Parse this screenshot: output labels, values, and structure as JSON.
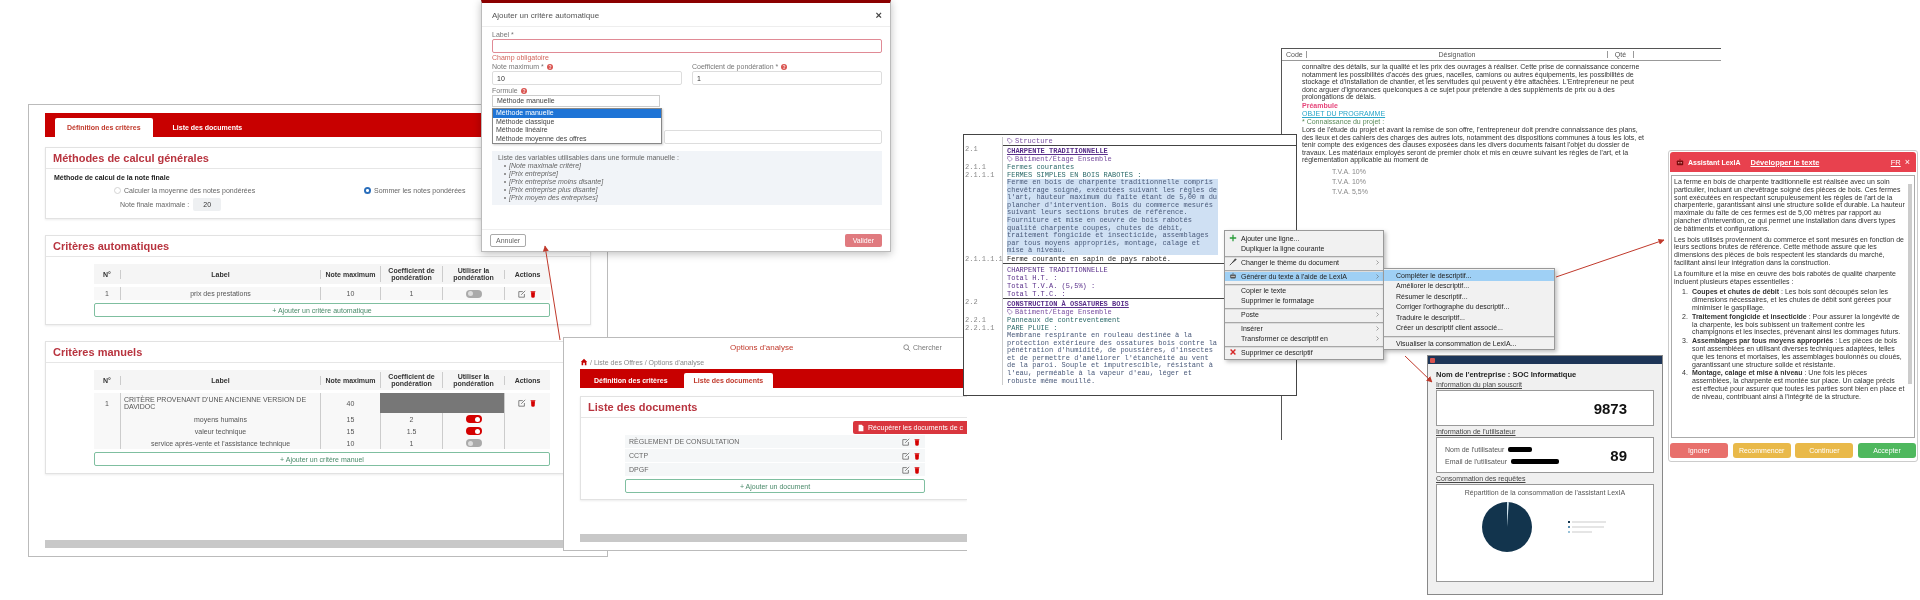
{
  "criteria": {
    "tabs": [
      {
        "label": "Définition des critères",
        "selected": true
      },
      {
        "label": "Liste des documents",
        "selected": false
      }
    ],
    "general": {
      "heading": "Méthodes de calcul générales",
      "method_label": "Méthode de calcul de la note finale",
      "options": [
        {
          "label": "Calculer la moyenne des notes pondérées",
          "selected": false
        },
        {
          "label": "Sommer les notes pondérées",
          "selected": true
        }
      ],
      "max_label": "Note finale maximale :",
      "max_value": "20"
    },
    "auto": {
      "heading": "Critères automatiques",
      "columns": [
        "N°",
        "Label",
        "Note maximum",
        "Coefficient de pondération",
        "Utiliser la pondération",
        "Actions"
      ],
      "rows": [
        {
          "n": "1",
          "label": "prix des prestations",
          "max": "10",
          "coef": "1",
          "weighted": false
        }
      ],
      "add": "+ Ajouter un critère automatique"
    },
    "manual": {
      "heading": "Critères manuels",
      "columns": [
        "N°",
        "Label",
        "Note maximum",
        "Coefficient de pondération",
        "Utiliser la pondération",
        "Actions"
      ],
      "rows": [
        {
          "n": "1",
          "label": "CRITÈRE PROVENANT D'UNE ANCIENNE VERSION DE DAVIDOC",
          "max": "40",
          "sub_criteria": [
            {
              "label": "moyens humains",
              "max": "15",
              "coef": "2",
              "weighted": true
            },
            {
              "label": "valeur technique",
              "max": "15",
              "coef": "1.5",
              "weighted": true
            },
            {
              "label": "service après-vente et l'assistance technique",
              "max": "10",
              "coef": "1",
              "weighted": false
            }
          ]
        }
      ],
      "add": "+ Ajouter un critère manuel"
    }
  },
  "modal": {
    "title": "Ajouter un critère automatique",
    "close": "×",
    "label_field": {
      "label": "Label *",
      "error": "Champ obligatoire"
    },
    "note_field": {
      "label": "Note maximum *",
      "value": "10"
    },
    "coef_field": {
      "label": "Coefficient de pondération *",
      "value": "1"
    },
    "formula": {
      "label": "Formule",
      "value": "Méthode manuelle",
      "options": [
        {
          "label": "Méthode manuelle",
          "selected": true
        },
        {
          "label": "Méthode classique",
          "selected": false
        },
        {
          "label": "Méthode linéaire",
          "selected": false
        },
        {
          "label": "Méthode moyenne des offres",
          "selected": false
        }
      ]
    },
    "help": {
      "intro": "Liste des variables utilisables dans une formule manuelle :",
      "items": [
        "[Note maximale critère]",
        "[Prix entreprise]",
        "[Prix entreprise moins disante]",
        "[Prix entreprise plus disante]",
        "[Prix moyen des entreprises]"
      ]
    },
    "cancel": "Annuler",
    "submit": "Valider"
  },
  "documents": {
    "title": "Options d'analyse",
    "search_placeholder": "Chercher",
    "breadcrumb": "/ Liste des Offres / Options d'analyse",
    "tabs": [
      {
        "label": "Définition des critères",
        "selected": false
      },
      {
        "label": "Liste des documents",
        "selected": true
      }
    ],
    "heading": "Liste des documents",
    "fetch_button": "Récupérer les documents de c",
    "items": [
      "RÈGLEMENT DE CONSULTATION",
      "CCTP",
      "DPGF"
    ],
    "add": "+ Ajouter un document"
  },
  "background_doc": {
    "columns": [
      "Code",
      "Désignation",
      "Qté"
    ],
    "blocks": [
      {
        "kind": "text",
        "text": "connaître des détails, sur la qualité et les prix des ouvrages à réaliser. Cette prise de connaissance concerne notamment les possibilités d'accès des grues, nacelles, camions ou autres équipements, les possibilités de stockage et d'installation de chantier, et les servitudes qui peuvent y être attachées. L'Entrepreneur ne peut donc arguer d'ignorances quelconques à ce sujet pour prétendre à des suppléments de prix ou à des prolongations de délais."
      },
      {
        "kind": "heading",
        "text": "Préambule"
      },
      {
        "kind": "link",
        "text": "OBJET DU PROGRAMME"
      },
      {
        "kind": "note",
        "text": "* Connaissance du projet :"
      },
      {
        "kind": "text",
        "text": "Lors de l'étude du projet et avant la remise de son offre, l'entrepreneur doit prendre connaissance des plans, des lieux et des cahiers des charges des autres lots, notamment des dispositions communes à tous les lots, et tenir compte des exigences des clauses exposées dans les divers documents faisant l'objet du dossier de travaux. Les matériaux employés seront de premier choix et mis en œuvre suivant les règles de l'art, et la réglementation applicable au moment de"
      }
    ],
    "tva": [
      "T.V.A. 10%",
      "T.V.A. 10%",
      "T.V.A. 5,5%"
    ]
  },
  "editor": {
    "lines": [
      {
        "kind": "tag",
        "text": "Structure"
      },
      {
        "kind": "title",
        "num": "2.1",
        "text": "CHARPENTE TRADITIONNELLE"
      },
      {
        "kind": "tag",
        "text": "Bâtiment/Étage Ensemble"
      },
      {
        "kind": "subtitle",
        "num": "2.1.1",
        "text": "Fermes courantes"
      },
      {
        "kind": "item",
        "num": "2.1.1.1",
        "text": "FERMES SIMPLES EN BOIS RABOTÉS :"
      },
      {
        "kind": "para",
        "selected": true,
        "text": "Ferme en bois de charpente traditionnelle compris chevêtrage soigné, exécutées suivant les règles de l'art, hauteur maximum du faîte étant de 5,00 m du plancher d'intervention. Bois du commerce mesurés suivant leurs sections brutes de référence. Fourniture et mise en oeuvre de bois rabotés qualité charpente coupes, chutes de débit, traitement fongicide et insecticide, assemblages par tous moyens appropriés, montage, calage et mise à niveau."
      },
      {
        "kind": "line",
        "num": "2.1.1.1.1",
        "text": "Ferme courante en sapin de pays raboté."
      },
      {
        "kind": "total-title",
        "text": "CHARPENTE TRADITIONNELLE"
      },
      {
        "kind": "total",
        "text": "Total H.T. :"
      },
      {
        "kind": "total",
        "text": "Total T.V.A. (5,5%) :"
      },
      {
        "kind": "total",
        "text": "Total T.T.C. :"
      },
      {
        "kind": "title",
        "num": "2.2",
        "text": "CONSTRUCTION À OSSATURES BOIS"
      },
      {
        "kind": "tag",
        "text": "Bâtiment/Étage Ensemble"
      },
      {
        "kind": "subtitle",
        "num": "2.2.1",
        "text": "Panneaux de contreventement"
      },
      {
        "kind": "item",
        "num": "2.2.1.1",
        "text": "PARE PLUIE :"
      },
      {
        "kind": "para",
        "selected": false,
        "text": "Membrane respirante en rouleau destinée à la protection extérieure des ossatures bois contre la pénétration d'humidité, de poussières, d'insectes et de permettre d'améliorer l'étanchéité au vent de la paroi. Souple et imputrescible, résistant à l'eau, perméable à la vapeur d'eau, léger et robuste même mouillé."
      }
    ]
  },
  "context_menu": {
    "items": [
      {
        "label": "Ajouter une ligne...",
        "submenu": false,
        "selected": false,
        "separator_before": false
      },
      {
        "label": "Dupliquer la ligne courante",
        "submenu": false,
        "selected": false,
        "separator_before": false
      },
      {
        "label": "Changer le thème du document",
        "submenu": true,
        "selected": false,
        "separator_before": true
      },
      {
        "label": "Générer du texte à l'aide de LexIA",
        "submenu": true,
        "selected": true,
        "separator_before": true
      },
      {
        "label": "Copier le texte",
        "submenu": false,
        "selected": false,
        "separator_before": true
      },
      {
        "label": "Supprimer le formatage",
        "submenu": false,
        "selected": false,
        "separator_before": false
      },
      {
        "label": "Poste",
        "submenu": true,
        "selected": false,
        "separator_before": true
      },
      {
        "label": "Insérer",
        "submenu": true,
        "selected": false,
        "separator_before": true
      },
      {
        "label": "Transformer ce descriptif en",
        "submenu": true,
        "selected": false,
        "separator_before": false
      },
      {
        "label": "Supprimer ce descriptif",
        "submenu": false,
        "selected": false,
        "separator_before": true
      }
    ],
    "submenu": [
      {
        "label": "Compléter le descriptif...",
        "selected": true,
        "separator_before": false
      },
      {
        "label": "Améliorer le descriptif...",
        "selected": false,
        "separator_before": false
      },
      {
        "label": "Résumer le descriptif...",
        "selected": false,
        "separator_before": false
      },
      {
        "label": "Corriger l'orthographe du descriptif...",
        "selected": false,
        "separator_before": false
      },
      {
        "label": "Traduire le descriptif...",
        "selected": false,
        "separator_before": false
      },
      {
        "label": "Créer un descriptif client associé...",
        "selected": false,
        "separator_before": false
      },
      {
        "label": "Visualiser la consommation de LexIA...",
        "selected": false,
        "separator_before": true
      }
    ]
  },
  "usage_dialog": {
    "company": "Nom de l'entreprise : SOC Informatique",
    "plan": {
      "heading": "Information du plan souscrit",
      "stat": "9873"
    },
    "user": {
      "heading": "Information de l'utilisateur",
      "fields": [
        "Nom de l'utilisateur",
        "Email de l'utilisateur"
      ],
      "stat": "89"
    },
    "usage": {
      "heading": "Consommation des requêtes",
      "chart_title": "Répartition de la consommation de l'assistant LexIA"
    }
  },
  "assistant": {
    "title": "Assistant LexIA",
    "action": "Développer le texte",
    "lang": "FR",
    "close": "×",
    "paragraphs": [
      "La ferme en bois de charpente traditionnelle est réalisée avec un soin particulier, incluant un chevêtrage soigné des pièces de bois. Ces fermes sont exécutées en respectant scrupuleusement les règles de l'art de la charpenterie, garantissant ainsi une structure solide et durable. La hauteur maximale du faîte de ces fermes est de 5,00 mètres par rapport au plancher d'intervention, ce qui permet une installation dans divers types de bâtiments et configurations.",
      "Les bois utilisés proviennent du commerce et sont mesurés en fonction de leurs sections brutes de référence. Cette méthode assure que les dimensions des pièces de bois respectent les standards du marché, facilitant ainsi leur intégration dans la construction.",
      "La fourniture et la mise en œuvre des bois rabotés de qualité charpente incluent plusieurs étapes essentielles :"
    ],
    "steps": [
      {
        "num": "1.",
        "text": "**Coupes et chutes de débit** : Les bois sont découpés selon les dimensions nécessaires, et les chutes de débit sont gérées pour minimiser le gaspillage."
      },
      {
        "num": "2.",
        "text": "**Traitement fongicide et insecticide** : Pour assurer la longévité de la charpente, les bois subissent un traitement contre les champignons et les insectes, prévenant ainsi les dommages futurs."
      },
      {
        "num": "3.",
        "text": "**Assemblages par tous moyens appropriés** : Les pièces de bois sont assemblées en utilisant diverses techniques adaptées, telles que les tenons et mortaises, les assemblages boulonnés ou cloués, garantissant une structure solide et résistante."
      },
      {
        "num": "4.",
        "text": "**Montage, calage et mise à niveau** : Une fois les pièces assemblées, la charpente est montée sur place. Un calage précis est effectué pour assurer que toutes les parties sont bien en place et de niveau, contribuant ainsi à l'intégrité de la structure."
      }
    ],
    "buttons": [
      {
        "label": "Ignorer",
        "kind": "danger"
      },
      {
        "label": "Recommencer",
        "kind": "warning"
      },
      {
        "label": "Continuer",
        "kind": "warning"
      },
      {
        "label": "Accepter",
        "kind": "success"
      }
    ]
  }
}
